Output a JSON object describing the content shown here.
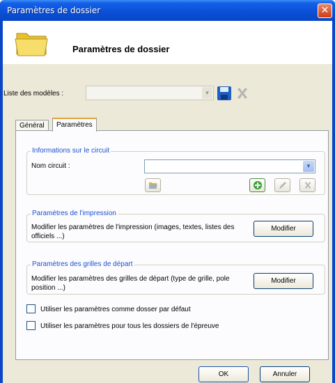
{
  "window": {
    "title": "Paramètres de dossier",
    "close_glyph": "✕"
  },
  "header": {
    "title": "Paramètres de dossier",
    "icon": "folder-icon"
  },
  "templates": {
    "label": "Liste des modèles :",
    "value": "",
    "save_icon": "save-icon",
    "delete_icon": "delete-icon"
  },
  "tabs": [
    {
      "label": "Général",
      "active": false
    },
    {
      "label": "Paramètres",
      "active": true
    }
  ],
  "circuit": {
    "group_title": "Informations sur le circuit",
    "name_label": "Nom circuit :",
    "name_value": "",
    "buttons": {
      "edit_icon": "pencil-icon",
      "add_icon": "plus-icon",
      "delete_icon": "delete-icon",
      "browse_icon": "folder-open-icon"
    }
  },
  "print": {
    "group_title": "Paramètres de l'impression",
    "description": "Modifier les paramètres de l'impression (images, textes, listes des officiels ...)",
    "button": "Modifier"
  },
  "grids": {
    "group_title": "Paramètres des grilles de départ",
    "description": "Modifier les paramètres des grilles de départ (type de grille, pole position ...)",
    "button": "Modifier"
  },
  "options": [
    {
      "label": "Utiliser les paramètres comme dosser par défaut",
      "checked": false
    },
    {
      "label": "Utiliser les paramètres pour tous les dossiers de l'épreuve",
      "checked": false
    }
  ],
  "footer": {
    "ok": "OK",
    "cancel": "Annuler"
  },
  "colors": {
    "titlebar": "#0a4fd6",
    "group_title": "#1c4fd0",
    "client": "#ece9d8",
    "tab_highlight": "#e6a13a"
  }
}
